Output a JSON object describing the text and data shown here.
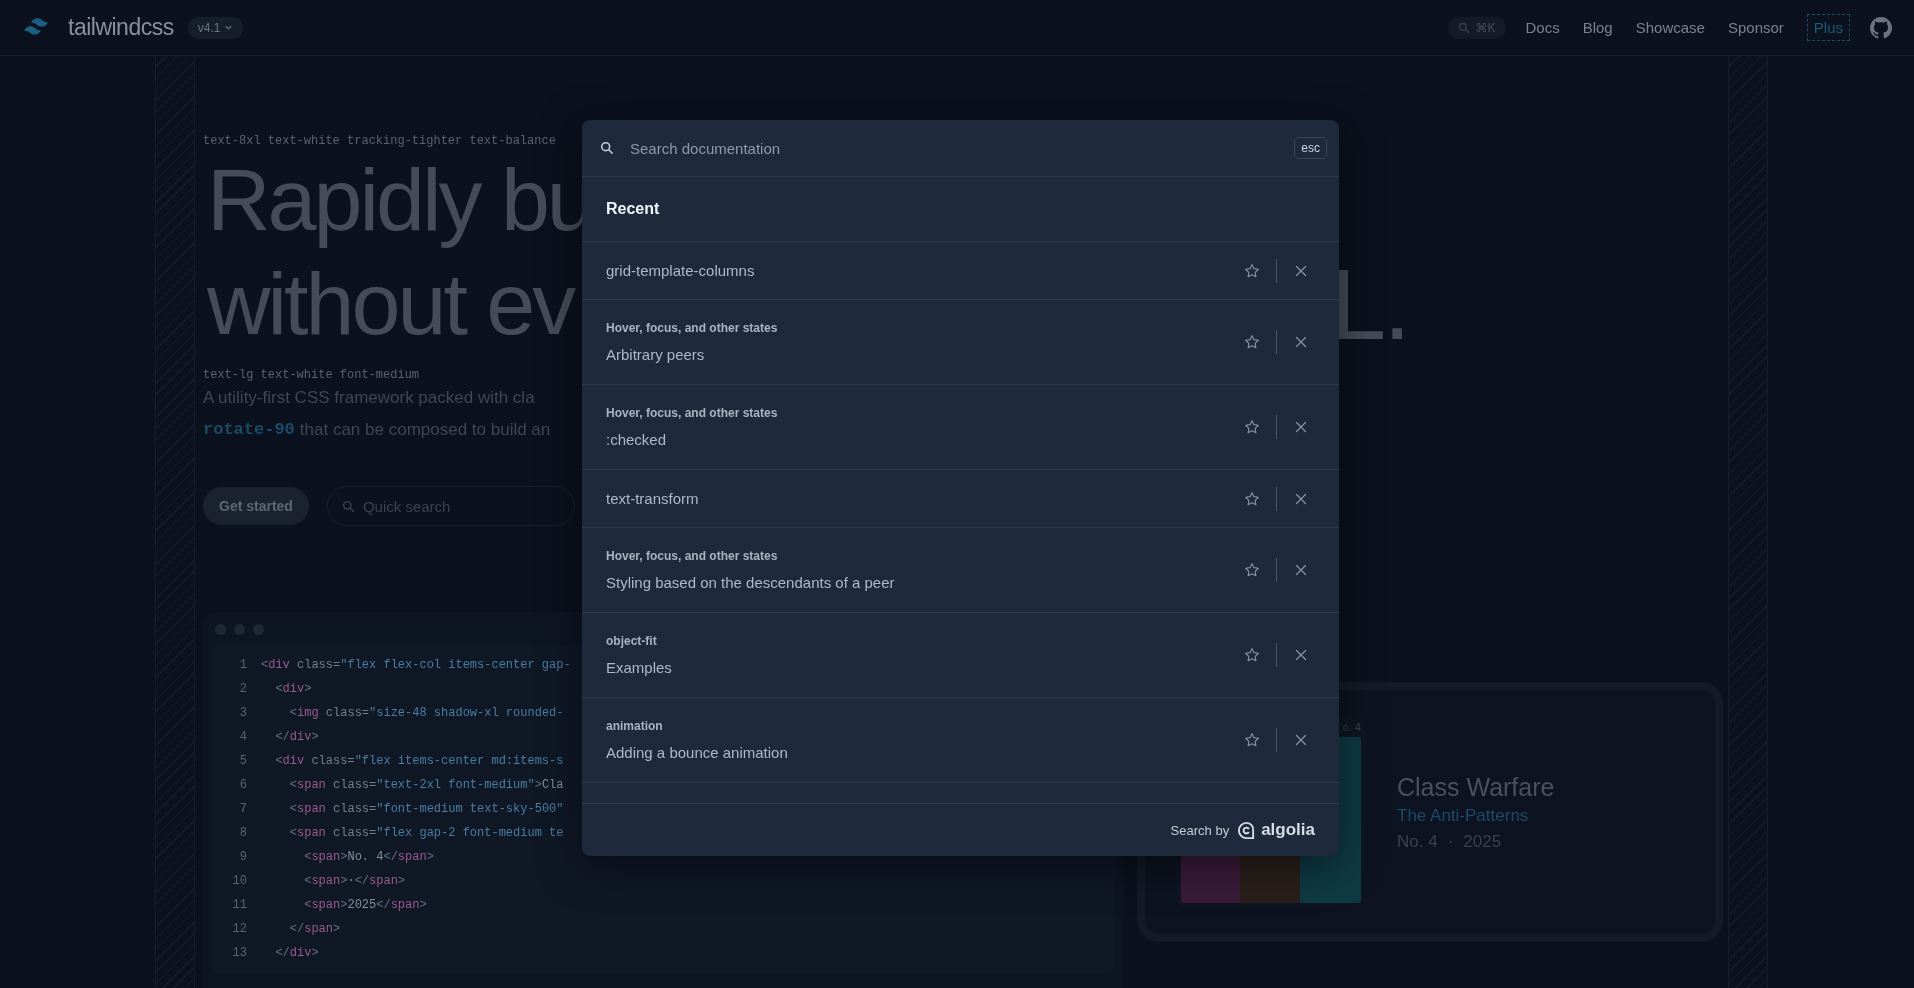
{
  "nav": {
    "logo": "tailwindcss",
    "version": "v4.1",
    "search_shortcut": "⌘K",
    "links": [
      "Docs",
      "Blog",
      "Showcase",
      "Sponsor"
    ],
    "plus": "Plus"
  },
  "hero": {
    "heading_label": "text-8xl text-white tracking-tighter text-balance",
    "heading_lines": [
      "Rapidly bu",
      "without ev"
    ],
    "heading_tail": "L.",
    "subtitle_label": "text-lg text-white font-medium",
    "subtitle_line_1": "A utility-first CSS framework packed with cla",
    "subtitle_code": "rotate-90",
    "subtitle_line_2": "that can be composed to build an",
    "primary_button": "Get started",
    "quick_search": {
      "placeholder": "Quick search"
    }
  },
  "code_window": {
    "lines": [
      {
        "number": "1",
        "code": "<div class=\"flex flex-col items-center gap-"
      },
      {
        "number": "2",
        "code": "  <div>"
      },
      {
        "number": "3",
        "code": "    <img class=\"size-48 shadow-xl rounded-"
      },
      {
        "number": "4",
        "code": "  </div>"
      },
      {
        "number": "5",
        "code": "  <div class=\"flex items-center md:items-s"
      },
      {
        "number": "6",
        "code": "    <span class=\"text-2xl font-medium\">Cla"
      },
      {
        "number": "7",
        "code": "    <span class=\"font-medium text-sky-500\""
      },
      {
        "number": "8",
        "code": "    <span class=\"flex gap-2 font-medium te"
      },
      {
        "number": "9",
        "code": "      <span>No. 4</span>"
      },
      {
        "number": "10",
        "code": "      <span>·</span>"
      },
      {
        "number": "11",
        "code": "      <span>2025</span>"
      },
      {
        "number": "12",
        "code": "    </span>"
      },
      {
        "number": "13",
        "code": "  </div>"
      }
    ]
  },
  "album_card": {
    "cover_label": "o. 4",
    "title": "Class Warfare",
    "artist": "The Anti-Patterns",
    "issue": "No. 4",
    "separator": "·",
    "year": "2025"
  },
  "search_modal": {
    "search": {
      "placeholder": "Search documentation"
    },
    "esc_key": "esc",
    "section_title": "Recent",
    "items": [
      {
        "title": "grid-template-columns"
      },
      {
        "category": "Hover, focus, and other states",
        "title": "Arbitrary peers"
      },
      {
        "category": "Hover, focus, and other states",
        "title": ":checked"
      },
      {
        "title": "text-transform"
      },
      {
        "category": "Hover, focus, and other states",
        "title": "Styling based on the descendants of a peer"
      },
      {
        "category": "object-fit",
        "title": "Examples"
      },
      {
        "category": "animation",
        "title": "Adding a bounce animation"
      }
    ],
    "footer": {
      "label": "Search by",
      "brand": "algolia"
    }
  }
}
